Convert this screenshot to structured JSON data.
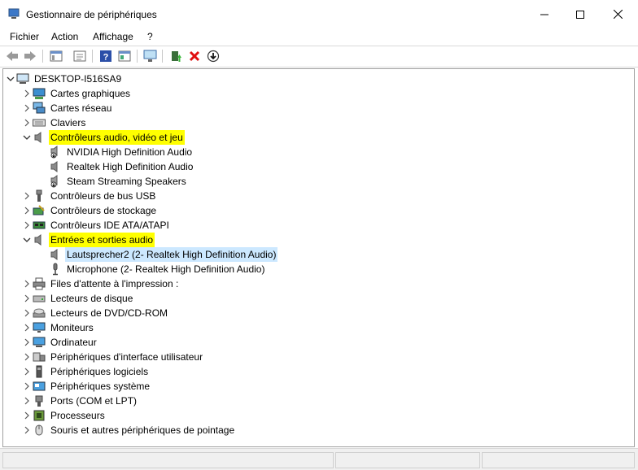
{
  "window": {
    "title": "Gestionnaire de périphériques"
  },
  "menu": [
    "Fichier",
    "Action",
    "Affichage",
    "?"
  ],
  "toolbar_icons": [
    "back-arrow-icon",
    "forward-arrow-icon",
    "show-hide-tree-icon",
    "properties-icon",
    "help-icon",
    "view-details-icon",
    "scan-hardware-icon",
    "update-driver-icon",
    "uninstall-device-icon",
    "disable-device-icon"
  ],
  "colors": {
    "highlight": "#ffff00",
    "selection": "#cce8ff"
  },
  "tree": {
    "root": "DESKTOP-I516SA9",
    "items": [
      {
        "label": "Cartes graphiques",
        "expanded": false,
        "icon": "display-adapter-icon"
      },
      {
        "label": "Cartes réseau",
        "expanded": false,
        "icon": "network-adapter-icon"
      },
      {
        "label": "Claviers",
        "expanded": false,
        "icon": "keyboard-icon"
      },
      {
        "label": "Contrôleurs audio, vidéo et jeu",
        "expanded": true,
        "highlighted": true,
        "icon": "speaker-icon",
        "children": [
          "NVIDIA High Definition Audio",
          "Realtek High Definition Audio",
          "Steam Streaming Speakers"
        ]
      },
      {
        "label": "Contrôleurs de bus USB",
        "expanded": false,
        "icon": "usb-icon"
      },
      {
        "label": "Contrôleurs de stockage",
        "expanded": false,
        "icon": "storage-controller-icon"
      },
      {
        "label": "Contrôleurs IDE ATA/ATAPI",
        "expanded": false,
        "icon": "ide-controller-icon"
      },
      {
        "label": "Entrées et sorties audio",
        "expanded": true,
        "highlighted": true,
        "icon": "speaker-icon",
        "children": [
          "Lautsprecher2 (2- Realtek High Definition Audio)",
          "Microphone (2- Realtek High Definition Audio)"
        ]
      },
      {
        "label": "Files d'attente à l'impression :",
        "expanded": false,
        "icon": "printer-icon"
      },
      {
        "label": "Lecteurs de disque",
        "expanded": false,
        "icon": "disk-drive-icon"
      },
      {
        "label": "Lecteurs de DVD/CD-ROM",
        "expanded": false,
        "icon": "dvd-drive-icon"
      },
      {
        "label": "Moniteurs",
        "expanded": false,
        "icon": "monitor-icon"
      },
      {
        "label": "Ordinateur",
        "expanded": false,
        "icon": "computer-icon"
      },
      {
        "label": "Périphériques d'interface utilisateur",
        "expanded": false,
        "icon": "hid-icon"
      },
      {
        "label": "Périphériques logiciels",
        "expanded": false,
        "icon": "software-device-icon"
      },
      {
        "label": "Périphériques système",
        "expanded": false,
        "icon": "system-device-icon"
      },
      {
        "label": "Ports (COM et LPT)",
        "expanded": false,
        "icon": "port-icon"
      },
      {
        "label": "Processeurs",
        "expanded": false,
        "icon": "processor-icon"
      },
      {
        "label": "Souris et autres périphériques de pointage",
        "expanded": false,
        "icon": "mouse-icon"
      }
    ]
  }
}
